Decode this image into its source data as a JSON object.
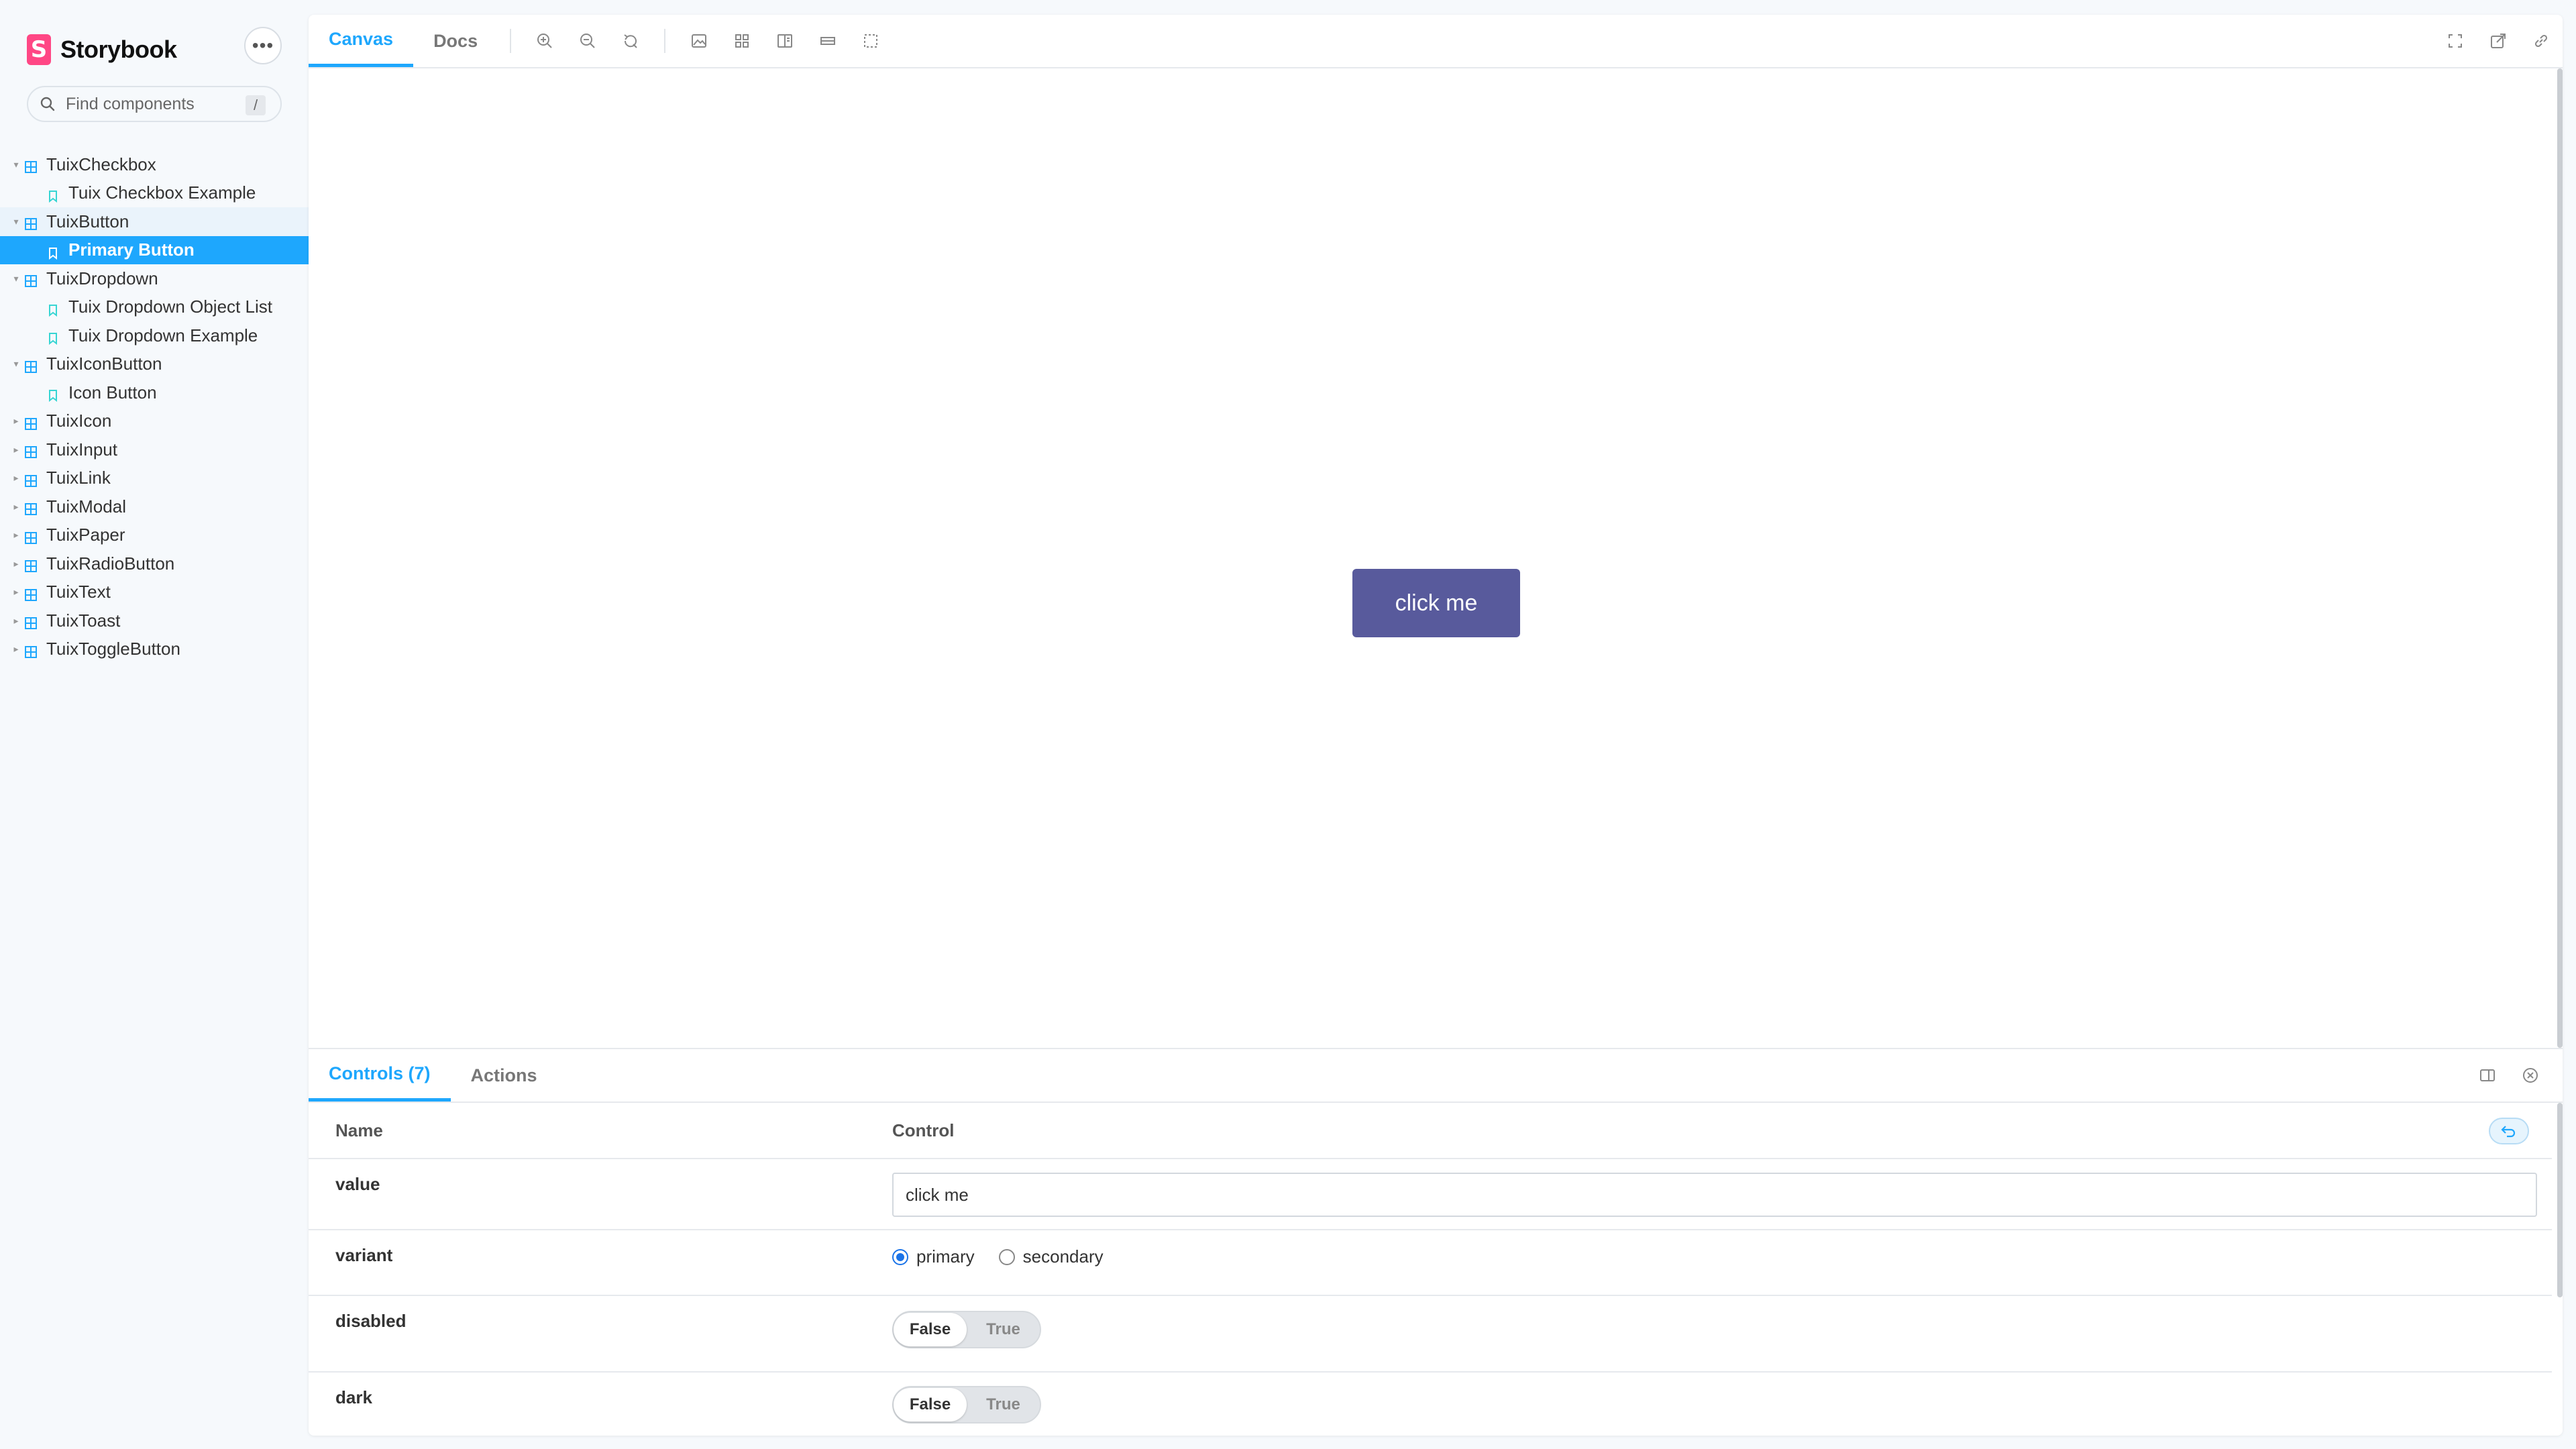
{
  "app": {
    "name": "Storybook",
    "logo_letter": "S"
  },
  "sidebar": {
    "menu_glyph": "•••",
    "search": {
      "placeholder": "Find components",
      "shortcut": "/"
    },
    "tree": [
      {
        "type": "component",
        "label": "TuixCheckbox",
        "open": true
      },
      {
        "type": "story",
        "label": "Tuix Checkbox Example"
      },
      {
        "type": "component",
        "label": "TuixButton",
        "open": true,
        "active_group": true
      },
      {
        "type": "story",
        "label": "Primary Button",
        "selected": true
      },
      {
        "type": "component",
        "label": "TuixDropdown",
        "open": true
      },
      {
        "type": "story",
        "label": "Tuix Dropdown Object List"
      },
      {
        "type": "story",
        "label": "Tuix Dropdown Example"
      },
      {
        "type": "component",
        "label": "TuixIconButton",
        "open": true
      },
      {
        "type": "story",
        "label": "Icon Button"
      },
      {
        "type": "component",
        "label": "TuixIcon"
      },
      {
        "type": "component",
        "label": "TuixInput"
      },
      {
        "type": "component",
        "label": "TuixLink"
      },
      {
        "type": "component",
        "label": "TuixModal"
      },
      {
        "type": "component",
        "label": "TuixPaper"
      },
      {
        "type": "component",
        "label": "TuixRadioButton"
      },
      {
        "type": "component",
        "label": "TuixText"
      },
      {
        "type": "component",
        "label": "TuixToast"
      },
      {
        "type": "component",
        "label": "TuixToggleButton"
      }
    ]
  },
  "toolbar": {
    "tabs": [
      {
        "label": "Canvas",
        "active": true
      },
      {
        "label": "Docs"
      }
    ],
    "tools": [
      "zoom-in-icon",
      "zoom-out-icon",
      "zoom-reset-icon",
      "background-icon",
      "grid-icon",
      "viewport-icon",
      "measure-icon",
      "outline-icon"
    ],
    "right_tools": [
      "fullscreen-icon",
      "open-new-tab-icon",
      "copy-link-icon"
    ]
  },
  "canvas": {
    "button_label": "click me",
    "button_color": "#585a9c"
  },
  "addons": {
    "tabs": [
      {
        "label": "Controls (7)",
        "active": true
      },
      {
        "label": "Actions"
      }
    ],
    "table": {
      "headers": {
        "name": "Name",
        "control": "Control"
      },
      "rows": {
        "value": {
          "name": "value",
          "input_value": "click me"
        },
        "variant": {
          "name": "variant",
          "options": [
            "primary",
            "secondary"
          ],
          "selected": "primary"
        },
        "disabled": {
          "name": "disabled",
          "false_label": "False",
          "true_label": "True",
          "value": false
        },
        "dark": {
          "name": "dark",
          "false_label": "False",
          "true_label": "True",
          "value": false
        }
      }
    }
  },
  "colors": {
    "accent": "#1ea7fd",
    "brand": "#ff4785",
    "selected_row": "#1ea7fd"
  }
}
